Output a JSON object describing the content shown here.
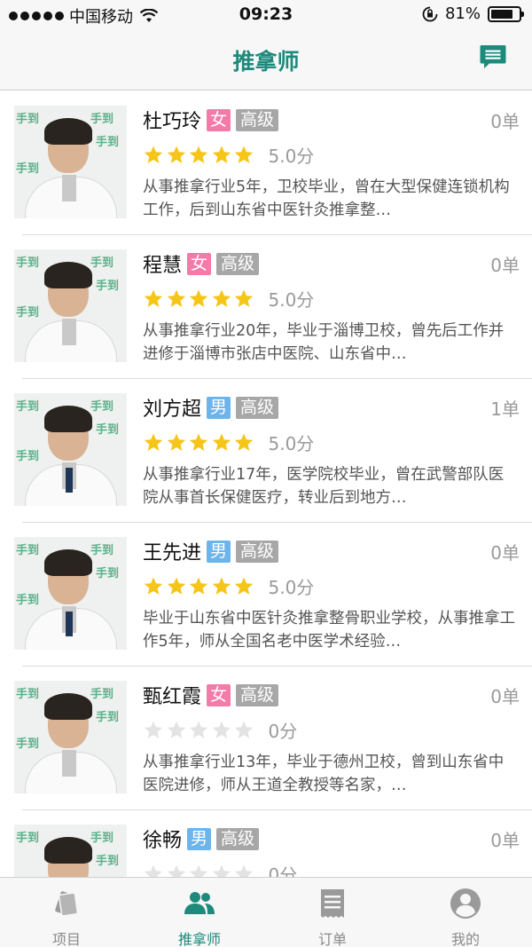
{
  "status_bar": {
    "carrier": "中国移动",
    "time": "09:23",
    "battery": "81%",
    "battery_level": 0.81
  },
  "nav": {
    "title": "推拿师"
  },
  "therapists": [
    {
      "name": "杜巧玲",
      "gender": "女",
      "gender_type": "female",
      "level": "高级",
      "orders": "0单",
      "rating": 5,
      "score": "5.0分",
      "description": "从事推拿行业5年，卫校毕业，曾在大型保健连锁机构工作，后到山东省中医针灸推拿整…"
    },
    {
      "name": "程慧",
      "gender": "女",
      "gender_type": "female",
      "level": "高级",
      "orders": "0单",
      "rating": 5,
      "score": "5.0分",
      "description": "从事推拿行业20年，毕业于淄博卫校，曾先后工作并进修于淄博市张店中医院、山东省中…"
    },
    {
      "name": "刘方超",
      "gender": "男",
      "gender_type": "male",
      "level": "高级",
      "orders": "1单",
      "rating": 5,
      "score": "5.0分",
      "description": "从事推拿行业17年，医学院校毕业，曾在武警部队医院从事首长保健医疗，转业后到地方…"
    },
    {
      "name": "王先进",
      "gender": "男",
      "gender_type": "male",
      "level": "高级",
      "orders": "0单",
      "rating": 5,
      "score": "5.0分",
      "description": "毕业于山东省中医针灸推拿整骨职业学校，从事推拿工作5年，师从全国名老中医学术经验…"
    },
    {
      "name": "甄红霞",
      "gender": "女",
      "gender_type": "female",
      "level": "高级",
      "orders": "0单",
      "rating": 0,
      "score": "0分",
      "description": "从事推拿行业13年，毕业于德州卫校，曾到山东省中医院进修，师从王道全教授等名家，…"
    },
    {
      "name": "徐畅",
      "gender": "男",
      "gender_type": "male",
      "level": "高级",
      "orders": "0单",
      "rating": 0,
      "score": "0分",
      "description": ""
    }
  ],
  "tab_bar": {
    "tabs": [
      {
        "label": "项目",
        "icon": "cards-icon"
      },
      {
        "label": "推拿师",
        "icon": "people-icon"
      },
      {
        "label": "订单",
        "icon": "receipt-icon"
      },
      {
        "label": "我的",
        "icon": "profile-icon"
      }
    ],
    "active_index": 1
  },
  "colors": {
    "accent": "#1e8a7c",
    "female_badge": "#f47aa8",
    "male_badge": "#6cb4ec",
    "level_badge": "#a7a7a7",
    "star_filled": "#f5c518",
    "star_empty": "#e3e3e3"
  }
}
